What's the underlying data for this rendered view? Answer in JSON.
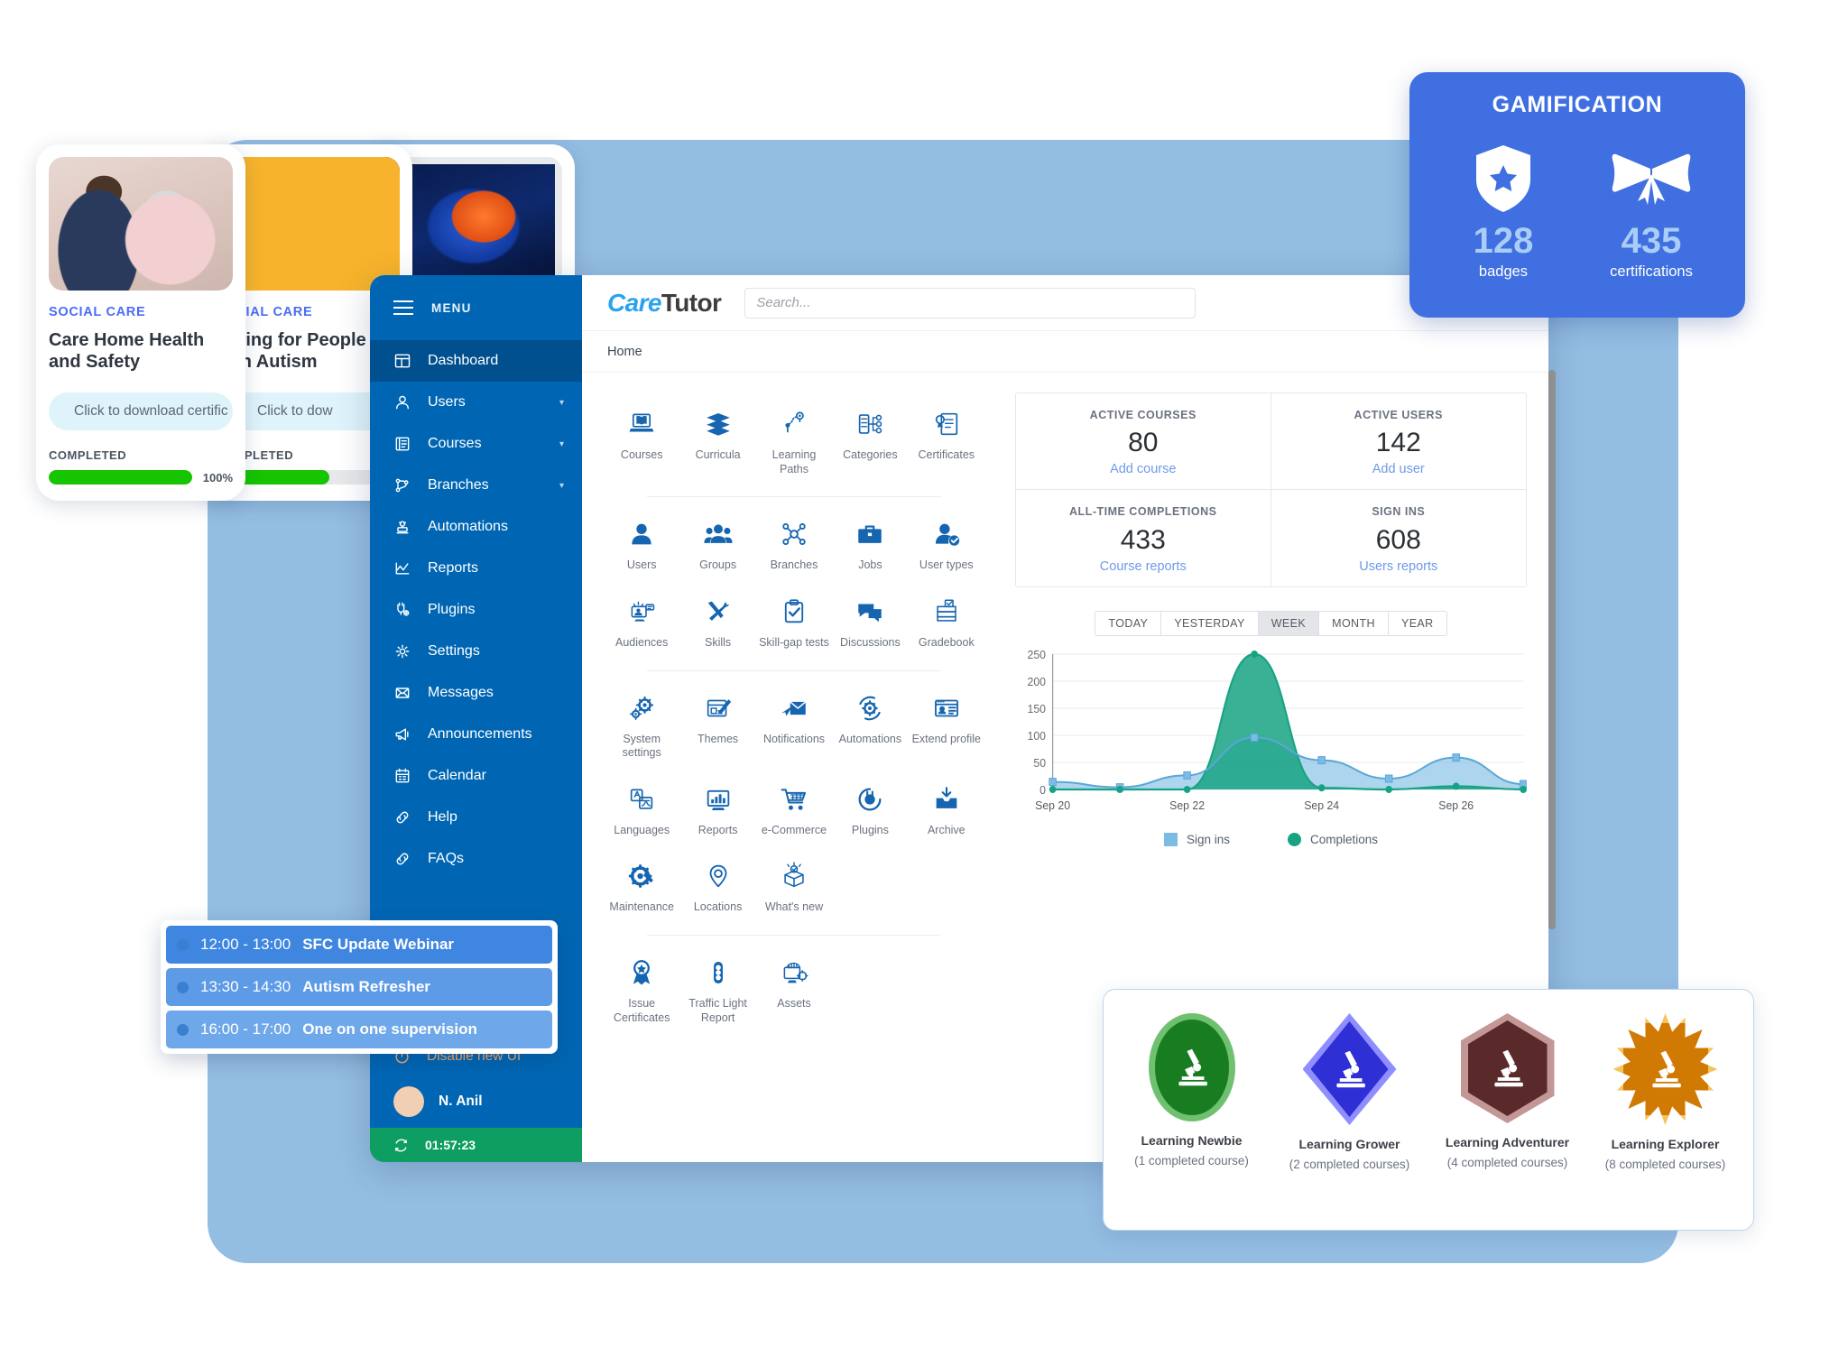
{
  "course_cards": [
    {
      "category": "SOCIAL CARE",
      "title": "Care Home Health and Safety",
      "cert_label": "Click to download certific",
      "status": "COMPLETED",
      "percent": "100%",
      "progress": 100,
      "thumb": "nurse-elderly-photo"
    },
    {
      "category": "SOCIAL CARE",
      "title": "Caring for People with Autism",
      "cert_label": "Click to dow",
      "status": "COMPLETED",
      "percent": "",
      "progress": 62,
      "thumb": "autism-ribbon-photo"
    },
    {
      "category": "",
      "title": "",
      "cert_label": "",
      "status": "",
      "percent": "",
      "progress": 0,
      "thumb": "brain-scan-photo"
    }
  ],
  "sidebar": {
    "menu_label": "MENU",
    "menu_icon": "hamburger-icon",
    "items": [
      {
        "label": "Dashboard",
        "icon": "dashboard-icon",
        "active": true,
        "caret": false
      },
      {
        "label": "Users",
        "icon": "user-icon",
        "active": false,
        "caret": true
      },
      {
        "label": "Courses",
        "icon": "book-icon",
        "active": false,
        "caret": true
      },
      {
        "label": "Branches",
        "icon": "branch-icon",
        "active": false,
        "caret": true
      },
      {
        "label": "Automations",
        "icon": "automation-icon",
        "active": false,
        "caret": false
      },
      {
        "label": "Reports",
        "icon": "chart-line-icon",
        "active": false,
        "caret": false
      },
      {
        "label": "Plugins",
        "icon": "plug-icon",
        "active": false,
        "caret": false
      },
      {
        "label": "Settings",
        "icon": "gear-icon",
        "active": false,
        "caret": false
      },
      {
        "label": "Messages",
        "icon": "envelope-icon",
        "active": false,
        "caret": false
      },
      {
        "label": "Announcements",
        "icon": "megaphone-icon",
        "active": false,
        "caret": false
      },
      {
        "label": "Calendar",
        "icon": "calendar-icon",
        "active": false,
        "caret": false
      },
      {
        "label": "Help",
        "icon": "link-icon",
        "active": false,
        "caret": false
      },
      {
        "label": "FAQs",
        "icon": "link-icon",
        "active": false,
        "caret": false
      }
    ],
    "disable_ui": {
      "label": "Disable new UI",
      "icon": "power-icon"
    },
    "user": {
      "name": "N. Anil",
      "avatar": "user-avatar"
    },
    "timer": {
      "value": "01:57:23",
      "icon": "refresh-icon"
    }
  },
  "topbar": {
    "logo_part1": "Care",
    "logo_part2": "Tutor",
    "search_placeholder": "Search..."
  },
  "breadcrumb": {
    "home": "Home"
  },
  "icon_grid": {
    "group1": [
      {
        "label": "Courses",
        "icon": "laptop-book-icon"
      },
      {
        "label": "Curricula",
        "icon": "stacked-books-icon"
      },
      {
        "label": "Learning Paths",
        "icon": "learning-path-icon"
      },
      {
        "label": "Categories",
        "icon": "categories-checklist-icon"
      },
      {
        "label": "Certificates",
        "icon": "certificate-icon"
      }
    ],
    "group2": [
      {
        "label": "Users",
        "icon": "user-solid-icon"
      },
      {
        "label": "Groups",
        "icon": "group-people-icon"
      },
      {
        "label": "Branches",
        "icon": "branch-network-icon"
      },
      {
        "label": "Jobs",
        "icon": "briefcase-icon"
      },
      {
        "label": "User types",
        "icon": "user-check-icon"
      },
      {
        "label": "Audiences",
        "icon": "audience-screen-icon"
      },
      {
        "label": "Skills",
        "icon": "wrench-pencil-icon"
      },
      {
        "label": "Skill-gap tests",
        "icon": "clipboard-check-icon"
      },
      {
        "label": "Discussions",
        "icon": "chat-bubbles-icon"
      },
      {
        "label": "Gradebook",
        "icon": "gradebook-icon"
      }
    ],
    "group3": [
      {
        "label": "System settings",
        "icon": "gears-icon"
      },
      {
        "label": "Themes",
        "icon": "theme-brush-icon"
      },
      {
        "label": "Notifications",
        "icon": "mail-send-icon"
      },
      {
        "label": "Automations",
        "icon": "gear-cycle-icon"
      },
      {
        "label": "Extend profile",
        "icon": "profile-card-icon"
      },
      {
        "label": "Languages",
        "icon": "languages-icon"
      },
      {
        "label": "Reports",
        "icon": "report-monitor-icon"
      },
      {
        "label": "e-Commerce",
        "icon": "shopping-cart-icon"
      },
      {
        "label": "Plugins",
        "icon": "plug-circle-icon"
      },
      {
        "label": "Archive",
        "icon": "archive-download-icon"
      },
      {
        "label": "Maintenance",
        "icon": "gear-wrench-icon"
      },
      {
        "label": "Locations",
        "icon": "map-pin-icon"
      },
      {
        "label": "What's new",
        "icon": "open-box-icon"
      }
    ],
    "group4": [
      {
        "label": "Issue Certificates",
        "icon": "award-ribbon-icon"
      },
      {
        "label": "Traffic Light Report",
        "icon": "traffic-light-icon"
      },
      {
        "label": "Assets",
        "icon": "assets-monitor-icon"
      }
    ]
  },
  "stats": [
    {
      "title": "ACTIVE COURSES",
      "value": "80",
      "link": "Add course"
    },
    {
      "title": "ACTIVE USERS",
      "value": "142",
      "link": "Add user"
    },
    {
      "title": "ALL-TIME COMPLETIONS",
      "value": "433",
      "link": "Course reports"
    },
    {
      "title": "SIGN INS",
      "value": "608",
      "link": "Users reports"
    }
  ],
  "chart_ranges": [
    {
      "label": "TODAY",
      "active": false
    },
    {
      "label": "YESTERDAY",
      "active": false
    },
    {
      "label": "WEEK",
      "active": true
    },
    {
      "label": "MONTH",
      "active": false
    },
    {
      "label": "YEAR",
      "active": false
    }
  ],
  "chart_data": {
    "type": "area",
    "title": "",
    "xlabel": "",
    "ylabel": "",
    "ylim": [
      0,
      250
    ],
    "yticks": [
      0,
      50,
      100,
      150,
      200,
      250
    ],
    "x": [
      "Sep 20",
      "Sep 21",
      "Sep 22",
      "Sep 23",
      "Sep 24",
      "Sep 25",
      "Sep 26",
      "Sep 27"
    ],
    "xtick_labels": [
      "Sep 20",
      "Sep 22",
      "Sep 24",
      "Sep 26"
    ],
    "grid": true,
    "legend_position": "bottom",
    "series": [
      {
        "name": "Sign ins",
        "color": "#7cbbe4",
        "values": [
          14,
          4,
          26,
          96,
          54,
          20,
          59,
          10
        ]
      },
      {
        "name": "Completions",
        "color": "#17a383",
        "values": [
          0,
          0,
          0,
          250,
          3,
          0,
          6,
          0
        ]
      }
    ]
  },
  "gamification": {
    "title": "GAMIFICATION",
    "items": [
      {
        "icon": "shield-star-icon",
        "value": "128",
        "caption": "badges"
      },
      {
        "icon": "ribbon-bow-icon",
        "value": "435",
        "caption": "certifications"
      }
    ]
  },
  "badges": [
    {
      "name": "Learning Newbie",
      "sub": "(1 completed course)",
      "shape": "oval",
      "icon": "microscope-icon",
      "fill": "#177d20",
      "ring": "#6fc06f"
    },
    {
      "name": "Learning Grower",
      "sub": "(2 completed courses)",
      "shape": "diamond",
      "icon": "microscope-icon",
      "fill": "#2f2fd6",
      "ring": "#8e8eff"
    },
    {
      "name": "Learning Adventurer",
      "sub": "(4 completed courses)",
      "shape": "hexagon",
      "icon": "microscope-icon",
      "fill": "#5a2a2a",
      "ring": "#c49797"
    },
    {
      "name": "Learning Explorer",
      "sub": "(8 completed courses)",
      "shape": "starburst",
      "icon": "microscope-icon",
      "fill": "#d07a04",
      "ring": "#f5c35a"
    }
  ],
  "schedule": [
    {
      "time": "12:00 - 13:00",
      "title": "SFC Update Webinar"
    },
    {
      "time": "13:30 - 14:30",
      "title": "Autism Refresher"
    },
    {
      "time": "16:00 - 17:00",
      "title": "One on one supervision"
    }
  ]
}
